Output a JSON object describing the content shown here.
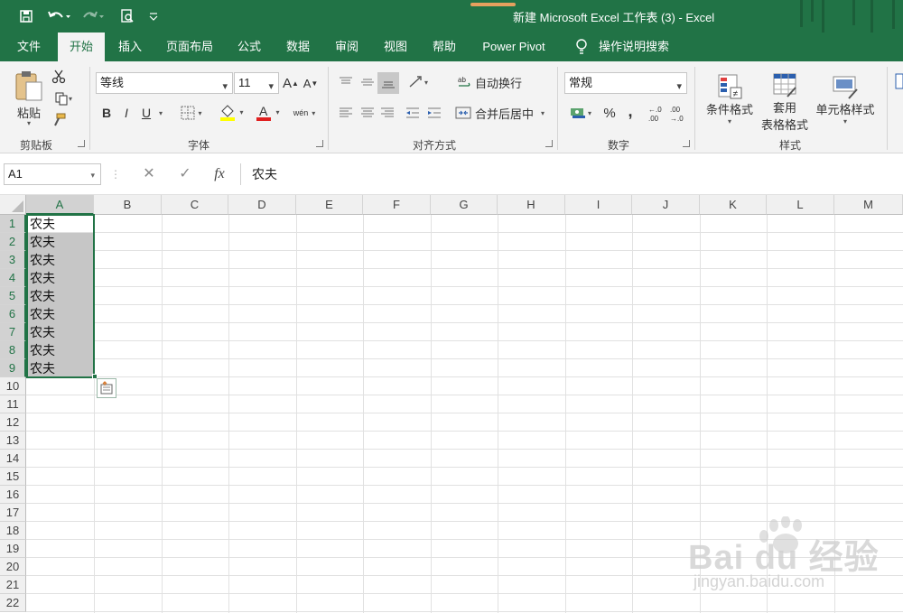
{
  "window": {
    "title": "新建 Microsoft Excel 工作表 (3)  -  Excel"
  },
  "quick_access": {
    "icons": [
      "save-icon",
      "undo-icon",
      "redo-icon",
      "print-preview-icon",
      "customize-icon"
    ]
  },
  "tabs": [
    {
      "label": "文件"
    },
    {
      "label": "开始"
    },
    {
      "label": "插入"
    },
    {
      "label": "页面布局"
    },
    {
      "label": "公式"
    },
    {
      "label": "数据"
    },
    {
      "label": "审阅"
    },
    {
      "label": "视图"
    },
    {
      "label": "帮助"
    },
    {
      "label": "Power Pivot"
    },
    {
      "label": "操作说明搜索"
    }
  ],
  "ribbon": {
    "clipboard": {
      "paste_label": "粘贴",
      "group_label": "剪贴板"
    },
    "font": {
      "font_name": "等线",
      "font_size": "11",
      "group_label": "字体",
      "bold": "B",
      "italic": "I",
      "underline": "U",
      "grow": "A",
      "shrink": "A",
      "phonetic": "wén"
    },
    "alignment": {
      "wrap_label": "自动换行",
      "merge_label": "合并后居中",
      "group_label": "对齐方式"
    },
    "number": {
      "format": "常规",
      "group_label": "数字",
      "percent": "%",
      "comma": ","
    },
    "styles": {
      "conditional_label": "条件格式",
      "table_label_1": "套用",
      "table_label_2": "表格格式",
      "cell_styles_label": "单元格样式",
      "group_label": "样式"
    }
  },
  "formula_bar": {
    "name_box": "A1",
    "cancel": "✕",
    "enter": "✓",
    "fx": "fx",
    "content": "农夫"
  },
  "sheet": {
    "columns": [
      "A",
      "B",
      "C",
      "D",
      "E",
      "F",
      "G",
      "H",
      "I",
      "J",
      "K",
      "L",
      "M"
    ],
    "rows": [
      "1",
      "2",
      "3",
      "4",
      "5",
      "6",
      "7",
      "8",
      "9",
      "10",
      "11",
      "12",
      "13",
      "14",
      "15",
      "16",
      "17",
      "18",
      "19",
      "20",
      "21",
      "22"
    ],
    "cells": {
      "A1": "农夫",
      "A2": "农夫",
      "A3": "农夫",
      "A4": "农夫",
      "A5": "农夫",
      "A6": "农夫",
      "A7": "农夫",
      "A8": "农夫",
      "A9": "农夫"
    },
    "active_cell": "A1",
    "selection": "A1:A9"
  },
  "watermark": {
    "brand": "Bai du 经验",
    "url": "jingyan.baidu.com"
  },
  "colors": {
    "excel_green": "#217346",
    "ribbon_bg": "#f3f3f3",
    "selection_shade": "#c6c6c6"
  }
}
